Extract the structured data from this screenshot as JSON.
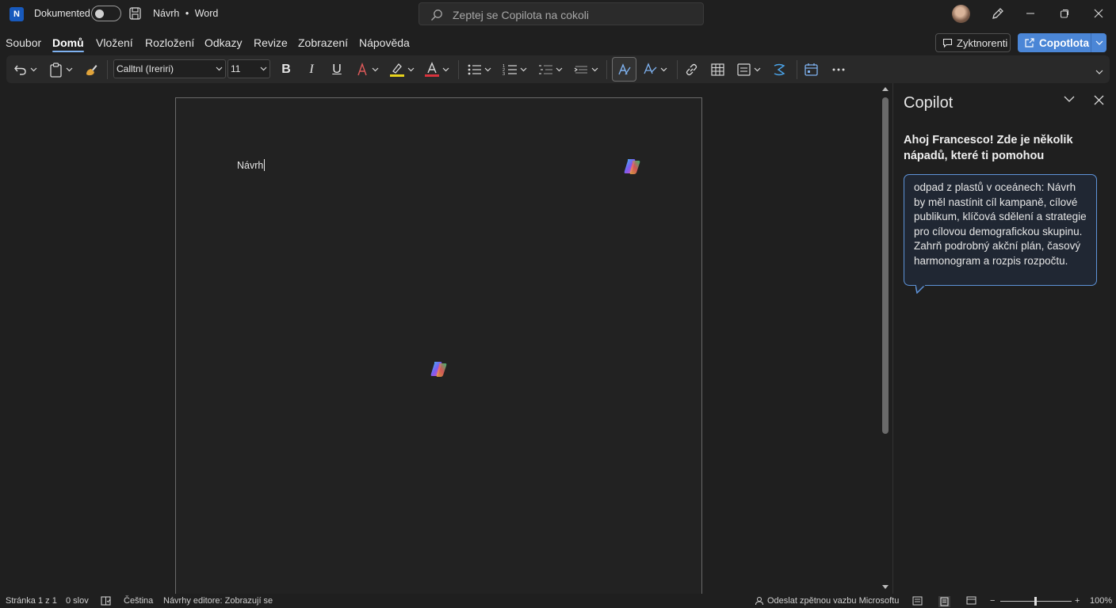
{
  "titlebar": {
    "app_icon_letter": "N",
    "autosave_label": "Dokumented",
    "doc_name": "Návrh",
    "separator": "•",
    "app_name": "Word",
    "search_placeholder": "Zeptej se Copilota na cokoli"
  },
  "menu": {
    "items": [
      "Soubor",
      "Domů",
      "Vložení",
      "Rozložení",
      "Odkazy",
      "Revize",
      "Zobrazení",
      "Nápověda"
    ],
    "active": "Domů",
    "comments_label": "Zyktnorenti",
    "copilot_label": "Copotlota"
  },
  "ribbon": {
    "font_name": "Calltnl (Ireriri)",
    "font_size": "11",
    "bold": "B",
    "italic": "I",
    "underline": "U",
    "font_color_letter": "A",
    "highlight_color": "#e8d31c",
    "font_color": "#d8323c"
  },
  "document": {
    "text": "Návrh"
  },
  "copilot_pane": {
    "title": "Copilot",
    "greeting": "Ahoj Francesco! Zde je několik nápadů, které ti pomohou",
    "suggestion": "odpad z plastů v oceánech: Návrh by měl nastínit cíl kampaně, cílové publikum, klíčová sdělení a strategie pro cílovou demografickou skupinu. Zahrň podrobný akční plán, časový harmonogram a rozpis rozpočtu."
  },
  "status": {
    "page": "Stránka 1 z 1",
    "words": "0 slov",
    "language": "Čeština",
    "editor": "Návrhy editore: Zobrazují se",
    "feedback": "Odeslat zpětnou vazbu Microsoftu",
    "zoom": "100%"
  },
  "colors": {
    "accent": "#4b86d6",
    "background": "#1f1f1f"
  }
}
